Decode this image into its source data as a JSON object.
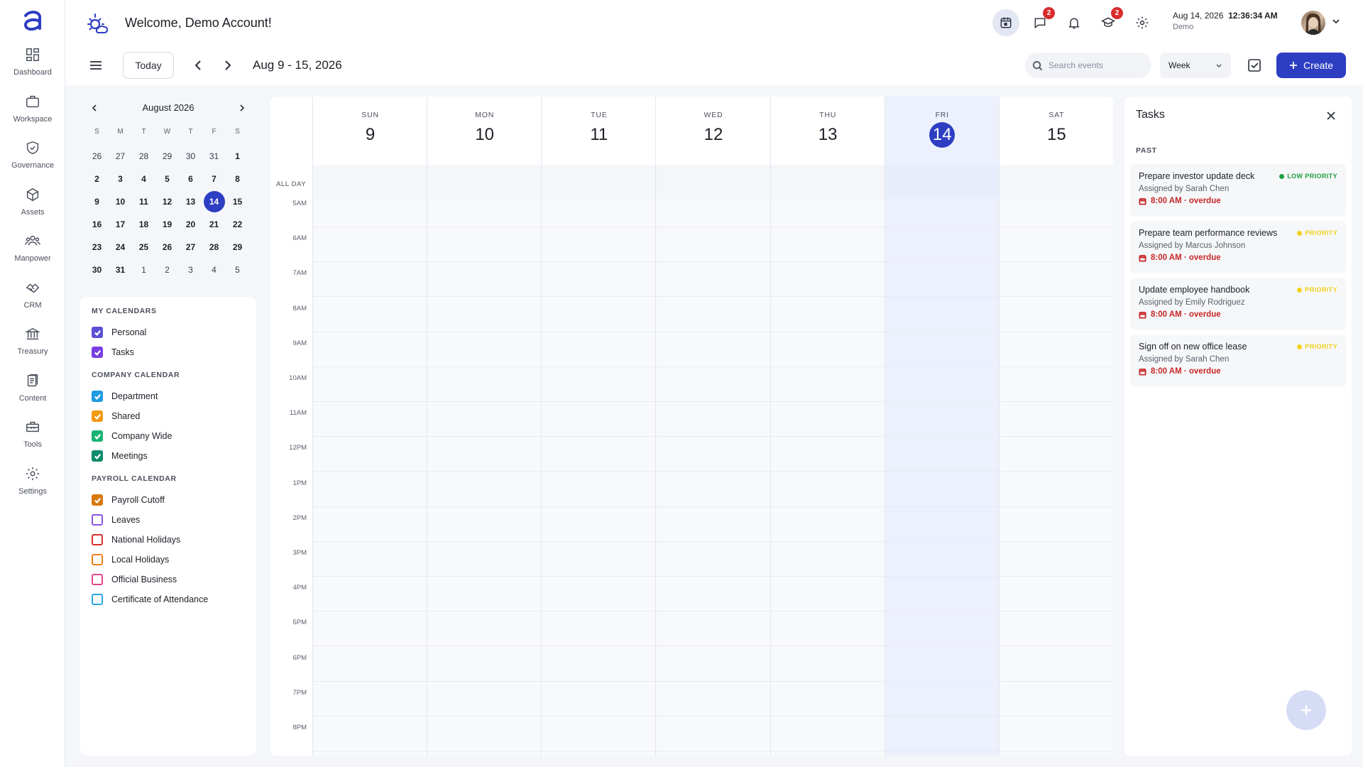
{
  "rail": {
    "items": [
      {
        "label": "Dashboard",
        "icon": "dashboard-icon"
      },
      {
        "label": "Workspace",
        "icon": "briefcase-icon"
      },
      {
        "label": "Governance",
        "icon": "shield-icon"
      },
      {
        "label": "Assets",
        "icon": "cube-icon"
      },
      {
        "label": "Manpower",
        "icon": "people-icon"
      },
      {
        "label": "CRM",
        "icon": "handshake-icon"
      },
      {
        "label": "Treasury",
        "icon": "bank-icon"
      },
      {
        "label": "Content",
        "icon": "document-icon"
      },
      {
        "label": "Tools",
        "icon": "toolbox-icon"
      },
      {
        "label": "Settings",
        "icon": "gear-icon"
      }
    ]
  },
  "header": {
    "welcome": "Welcome, Demo Account!",
    "messages_badge": "2",
    "academy_badge": "2",
    "datetime_date": "Aug 14, 2026",
    "datetime_time": "12:36:34 AM",
    "datetime_sub": "Demo"
  },
  "toolbar": {
    "today_label": "Today",
    "range_title": "Aug 9 - 15, 2026",
    "search_placeholder": "Search events",
    "view": "Week",
    "create_label": "Create"
  },
  "mini_calendar": {
    "title": "August 2026",
    "dow": [
      "S",
      "M",
      "T",
      "W",
      "T",
      "F",
      "S"
    ],
    "weeks": [
      [
        {
          "d": "26",
          "m": true
        },
        {
          "d": "27",
          "m": true
        },
        {
          "d": "28",
          "m": true
        },
        {
          "d": "29",
          "m": true
        },
        {
          "d": "30",
          "m": true
        },
        {
          "d": "31",
          "m": true
        },
        {
          "d": "1"
        }
      ],
      [
        {
          "d": "2"
        },
        {
          "d": "3"
        },
        {
          "d": "4"
        },
        {
          "d": "5"
        },
        {
          "d": "6"
        },
        {
          "d": "7"
        },
        {
          "d": "8"
        }
      ],
      [
        {
          "d": "9"
        },
        {
          "d": "10"
        },
        {
          "d": "11"
        },
        {
          "d": "12"
        },
        {
          "d": "13"
        },
        {
          "d": "14",
          "sel": true
        },
        {
          "d": "15"
        }
      ],
      [
        {
          "d": "16"
        },
        {
          "d": "17"
        },
        {
          "d": "18"
        },
        {
          "d": "19"
        },
        {
          "d": "20"
        },
        {
          "d": "21"
        },
        {
          "d": "22"
        }
      ],
      [
        {
          "d": "23"
        },
        {
          "d": "24"
        },
        {
          "d": "25"
        },
        {
          "d": "26"
        },
        {
          "d": "27"
        },
        {
          "d": "28"
        },
        {
          "d": "29"
        }
      ],
      [
        {
          "d": "30"
        },
        {
          "d": "31"
        },
        {
          "d": "1",
          "m": true
        },
        {
          "d": "2",
          "m": true
        },
        {
          "d": "3",
          "m": true
        },
        {
          "d": "4",
          "m": true
        },
        {
          "d": "5",
          "m": true
        }
      ]
    ]
  },
  "calendars": [
    {
      "section": "MY CALENDARS",
      "items": [
        {
          "name": "Personal",
          "color": "#5b4fd6",
          "checked": true
        },
        {
          "name": "Tasks",
          "color": "#7b3fe0",
          "checked": true
        }
      ]
    },
    {
      "section": "COMPANY CALENDAR",
      "items": [
        {
          "name": "Department",
          "color": "#1e9be0",
          "checked": true
        },
        {
          "name": "Shared",
          "color": "#f29a12",
          "checked": true
        },
        {
          "name": "Company Wide",
          "color": "#19b374",
          "checked": true
        },
        {
          "name": "Meetings",
          "color": "#0e8a6c",
          "checked": true
        }
      ]
    },
    {
      "section": "PAYROLL CALENDAR",
      "items": [
        {
          "name": "Payroll Cutoff",
          "color": "#d9780e",
          "checked": true
        },
        {
          "name": "Leaves",
          "color": "#8a55e6",
          "checked": false
        },
        {
          "name": "National Holidays",
          "color": "#d92c2c",
          "checked": false
        },
        {
          "name": "Local Holidays",
          "color": "#f0821a",
          "checked": false
        },
        {
          "name": "Official Business",
          "color": "#e0458a",
          "checked": false
        },
        {
          "name": "Certificate of Attendance",
          "color": "#2aa8e6",
          "checked": false
        }
      ]
    }
  ],
  "week": {
    "days": [
      {
        "name": "SUN",
        "num": "9"
      },
      {
        "name": "MON",
        "num": "10"
      },
      {
        "name": "TUE",
        "num": "11"
      },
      {
        "name": "WED",
        "num": "12"
      },
      {
        "name": "THU",
        "num": "13"
      },
      {
        "name": "FRI",
        "num": "14",
        "today": true
      },
      {
        "name": "SAT",
        "num": "15"
      }
    ],
    "all_day_label": "ALL DAY",
    "hours": [
      "5AM",
      "6AM",
      "7AM",
      "8AM",
      "9AM",
      "10AM",
      "11AM",
      "12PM",
      "1PM",
      "2PM",
      "3PM",
      "4PM",
      "5PM",
      "6PM",
      "7PM",
      "8PM"
    ]
  },
  "tasks_panel": {
    "title": "Tasks",
    "past_label": "PAST",
    "items": [
      {
        "title": "Prepare investor update deck",
        "by": "Assigned by Sarah Chen",
        "time": "8:00 AM · overdue",
        "priority": "LOW PRIORITY",
        "priority_color": "#1f9d3a"
      },
      {
        "title": "Prepare team performance reviews",
        "by": "Assigned by Marcus Johnson",
        "time": "8:00 AM · overdue",
        "priority": "PRIORITY",
        "priority_color": "#f2d21b"
      },
      {
        "title": "Update employee handbook",
        "by": "Assigned by Emily Rodriguez",
        "time": "8:00 AM · overdue",
        "priority": "PRIORITY",
        "priority_color": "#f2d21b"
      },
      {
        "title": "Sign off on new office lease",
        "by": "Assigned by Sarah Chen",
        "time": "8:00 AM · overdue",
        "priority": "PRIORITY",
        "priority_color": "#f2d21b"
      }
    ]
  },
  "colors": {
    "accent": "#2d3ec3",
    "overdue": "#c82828"
  }
}
